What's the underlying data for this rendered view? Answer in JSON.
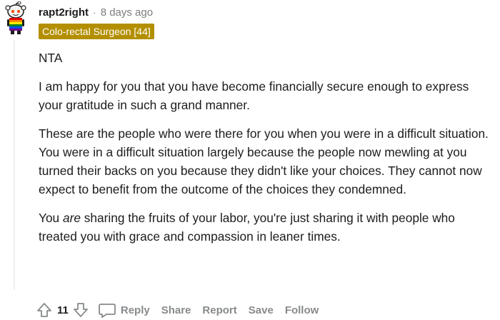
{
  "comment": {
    "username": "rapt2right",
    "separator": "·",
    "time": "8 days ago",
    "flair": "Colo-rectal Surgeon [44]",
    "paragraphs": {
      "p1": "NTA",
      "p2": "I am happy for you that you have become financially secure enough to express your gratitude in such a grand manner.",
      "p3": "These are the people who were there for you when you were in a difficult situation. You were in a difficult situation largely because the people now mewling at you turned their backs on you because they didn't like your choices. They cannot now expect to benefit from the outcome of the choices they condemned.",
      "p4_pre": "You ",
      "p4_em": "are",
      "p4_post": " sharing the fruits of your labor, you're just sharing it with people who treated you with grace and compassion in leaner times."
    }
  },
  "actions": {
    "score": "11",
    "reply": "Reply",
    "share": "Share",
    "report": "Report",
    "save": "Save",
    "follow": "Follow"
  },
  "colors": {
    "flair_bg": "#b38f00",
    "muted": "#878a8c",
    "text": "#1c1c1c"
  },
  "icons": {
    "avatar": "snoo-avatar-icon",
    "upvote": "upvote-arrow-icon",
    "downvote": "downvote-arrow-icon",
    "reply": "speech-bubble-icon"
  }
}
